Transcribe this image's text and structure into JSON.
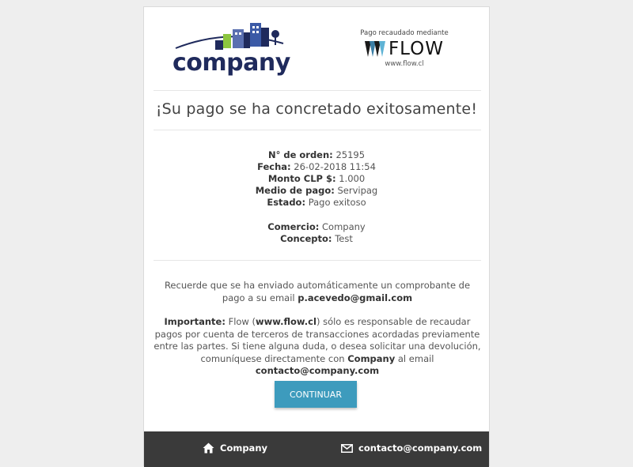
{
  "colors": {
    "button": "#3d9bbd",
    "footer": "#3a3a3a",
    "logo_text": "#1f2a5c"
  },
  "logo": {
    "company_word": "company",
    "flow_caption": "Pago recaudado mediante",
    "flow_word": "FLOW",
    "flow_url": "www.flow.cl"
  },
  "title": "¡Su pago se ha concretado exitosamente!",
  "details": [
    {
      "label": "N° de orden",
      "value": "25195"
    },
    {
      "label": "Fecha",
      "value": "26-02-2018 11:54"
    },
    {
      "label": "Monto CLP $",
      "value": "1.000"
    },
    {
      "label": "Medio de pago",
      "value": "Servipag"
    },
    {
      "label": "Estado",
      "value": "Pago exitoso"
    }
  ],
  "details2": [
    {
      "label": "Comercio",
      "value": "Company"
    },
    {
      "label": "Concepto",
      "value": "Test"
    }
  ],
  "notice": {
    "text": "Recuerde que se ha enviado automáticamente un comprobante de pago a su email ",
    "email": "p.acevedo@gmail.com"
  },
  "important": {
    "label": "Importante:",
    "t1": " Flow (",
    "flow_link": "www.flow.cl",
    "t2": ") sólo es responsable de recaudar pagos por cuenta de terceros de transacciones acordadas previamente entre las partes. Si tiene alguna duda, o desea solicitar una devolución, comuníquese directamente con ",
    "company": "Company",
    "t3": " al email ",
    "email": "contacto@company.com"
  },
  "button_label": "CONTINUAR",
  "footer": {
    "company": "Company",
    "email": "contacto@company.com"
  }
}
